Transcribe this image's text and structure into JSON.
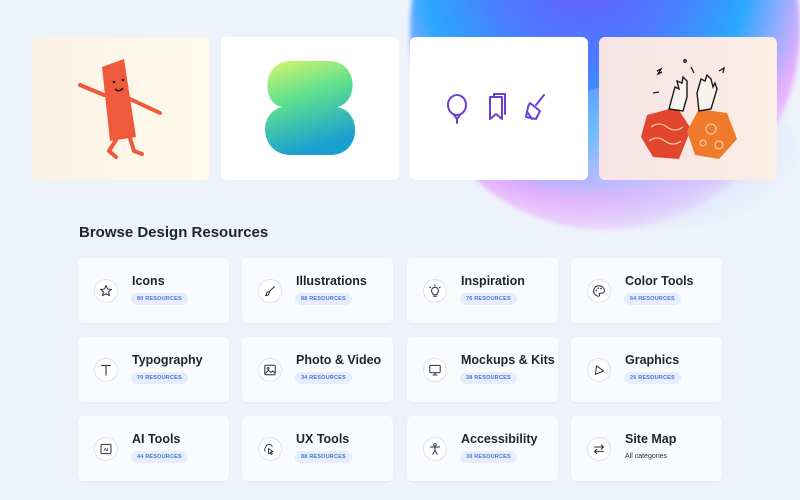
{
  "section": {
    "title": "Browse Design Resources"
  },
  "categories": [
    {
      "name": "Icons",
      "count": "80 RESOURCES",
      "icon": "star-icon"
    },
    {
      "name": "Illustrations",
      "count": "88 RESOURCES",
      "icon": "brush-icon"
    },
    {
      "name": "Inspiration",
      "count": "76 RESOURCES",
      "icon": "lightbulb-icon"
    },
    {
      "name": "Color Tools",
      "count": "64 RESOURCES",
      "icon": "palette-icon"
    },
    {
      "name": "Typography",
      "count": "70 RESOURCES",
      "icon": "text-t-icon"
    },
    {
      "name": "Photo & Video",
      "count": "34 RESOURCES",
      "icon": "image-icon"
    },
    {
      "name": "Mockups & Kits",
      "count": "38 RESOURCES",
      "icon": "monitor-icon"
    },
    {
      "name": "Graphics",
      "count": "26 RESOURCES",
      "icon": "triangle-icon"
    },
    {
      "name": "AI Tools",
      "count": "44 RESOURCES",
      "icon": "ai-chip-icon"
    },
    {
      "name": "UX Tools",
      "count": "88 RESOURCES",
      "icon": "cursor-click-icon"
    },
    {
      "name": "Accessibility",
      "count": "30 RESOURCES",
      "icon": "person-icon"
    }
  ],
  "sitemap": {
    "name": "Site Map",
    "subtitle": "All categories",
    "icon": "arrows-swap-icon"
  },
  "colors": {
    "accent": "#4b74d8",
    "icon_purple": "#6b3fd6",
    "card_bg": "#f9fbff",
    "page_bg": "#eef2fb"
  }
}
